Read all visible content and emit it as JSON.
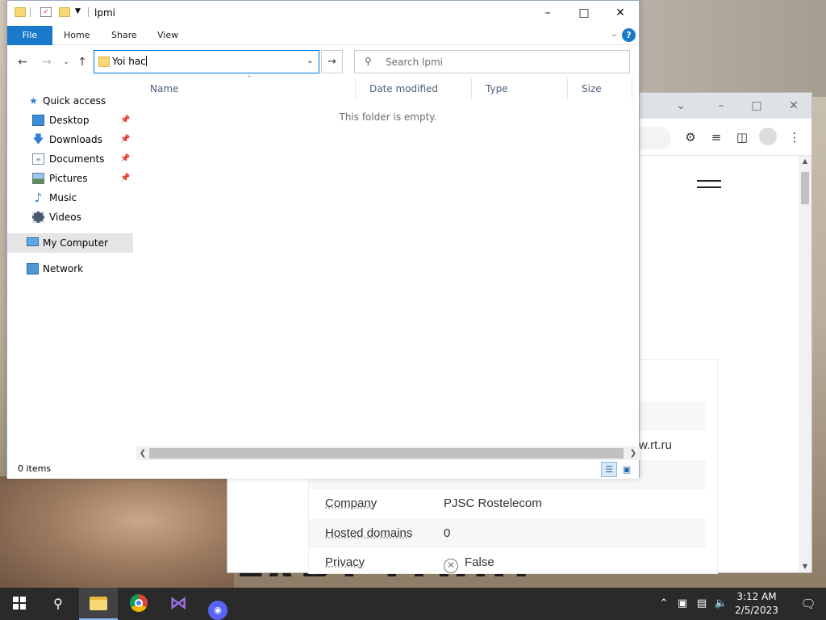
{
  "explorer": {
    "title": "lpmi",
    "ribbon_tabs": [
      "File",
      "Home",
      "Share",
      "View"
    ],
    "help_icon": "?",
    "address_value": "Yoi hac",
    "search_placeholder": "Search lpmi",
    "nav_items": [
      {
        "label": "Quick access",
        "icon": "star-icon",
        "pinned": false
      },
      {
        "label": "Desktop",
        "icon": "desktop-icon",
        "pinned": true
      },
      {
        "label": "Downloads",
        "icon": "download-icon",
        "pinned": true
      },
      {
        "label": "Documents",
        "icon": "documents-icon",
        "pinned": true
      },
      {
        "label": "Pictures",
        "icon": "pictures-icon",
        "pinned": true
      },
      {
        "label": "Music",
        "icon": "music-icon",
        "pinned": false
      },
      {
        "label": "Videos",
        "icon": "videos-icon",
        "pinned": false
      },
      {
        "label": "My Computer",
        "icon": "computer-icon",
        "pinned": false,
        "selected": true
      },
      {
        "label": "Network",
        "icon": "network-icon",
        "pinned": false
      }
    ],
    "columns": [
      "Name",
      "Date modified",
      "Type",
      "Size"
    ],
    "empty_message": "This folder is empty.",
    "status": "0 items",
    "accent_color": "#1979ca"
  },
  "browser": {
    "partial_url_tail": "w.rt.ru",
    "rows": [
      {
        "key": "Company",
        "value": "PJSC Rostelecom"
      },
      {
        "key": "Hosted domains",
        "value": "0"
      },
      {
        "key": "Privacy",
        "value": "False"
      }
    ]
  },
  "wallpaper": {
    "text": "FART LOUD"
  },
  "taskbar": {
    "time": "3:12 AM",
    "date": "2/5/2023",
    "apps": [
      "file-explorer-icon",
      "chrome-icon",
      "visual-studio-icon",
      "discord-icon"
    ]
  }
}
